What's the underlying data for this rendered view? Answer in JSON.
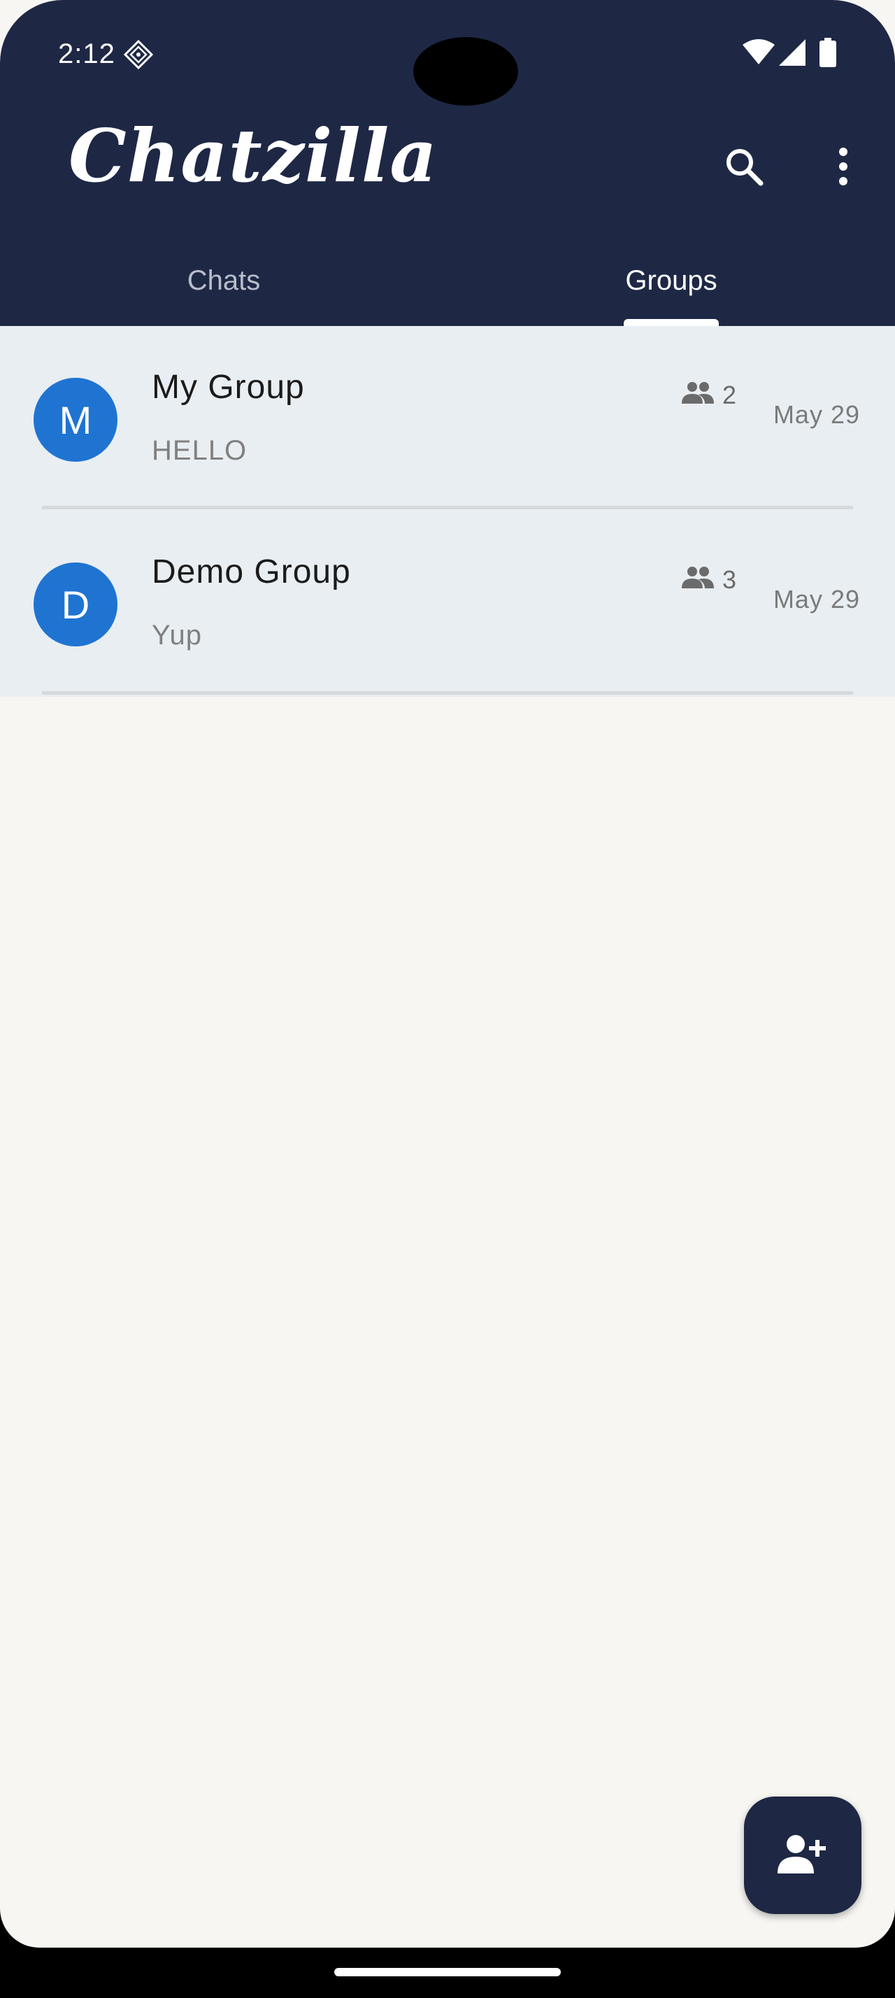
{
  "status_bar": {
    "time": "2:12"
  },
  "app": {
    "title": "Chatzilla"
  },
  "toolbar": {
    "search_icon": "search-icon",
    "menu_icon": "more-vert-icon"
  },
  "tabs": [
    {
      "label": "Chats",
      "active": false
    },
    {
      "label": "Groups",
      "active": true
    }
  ],
  "groups": [
    {
      "initial": "M",
      "name": "My Group",
      "last_message": "HELLO",
      "members": "2",
      "date": "May 29"
    },
    {
      "initial": "D",
      "name": "Demo Group",
      "last_message": "Yup",
      "members": "3",
      "date": "May 29"
    }
  ],
  "fab": {
    "icon": "add-person-icon"
  },
  "colors": {
    "appbar": "#1e2845",
    "avatar": "#1f74d2",
    "list_bg": "#e9eef2",
    "page_bg": "#f7f6f2"
  }
}
